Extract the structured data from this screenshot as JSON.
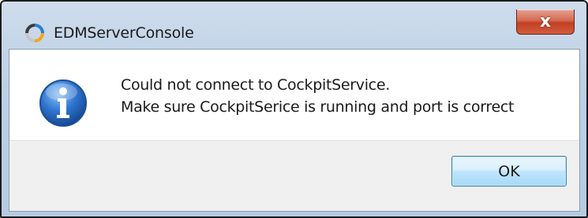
{
  "dialog": {
    "title": "EDMServerConsole",
    "close_glyph": "x",
    "app_icon": "edm-app-icon",
    "message_icon": "info-icon",
    "message_lines": [
      "Could not connect to CockpitService.",
      "Make sure CockpitSerice is running and port is correct"
    ],
    "ok_label": "OK"
  },
  "colors": {
    "titlebar": "#bcd0e6",
    "close_button": "#c33f22",
    "info_icon": "#1f5fb4",
    "button_area": "#f0f0f0",
    "ok_border": "#3c7fb1"
  }
}
